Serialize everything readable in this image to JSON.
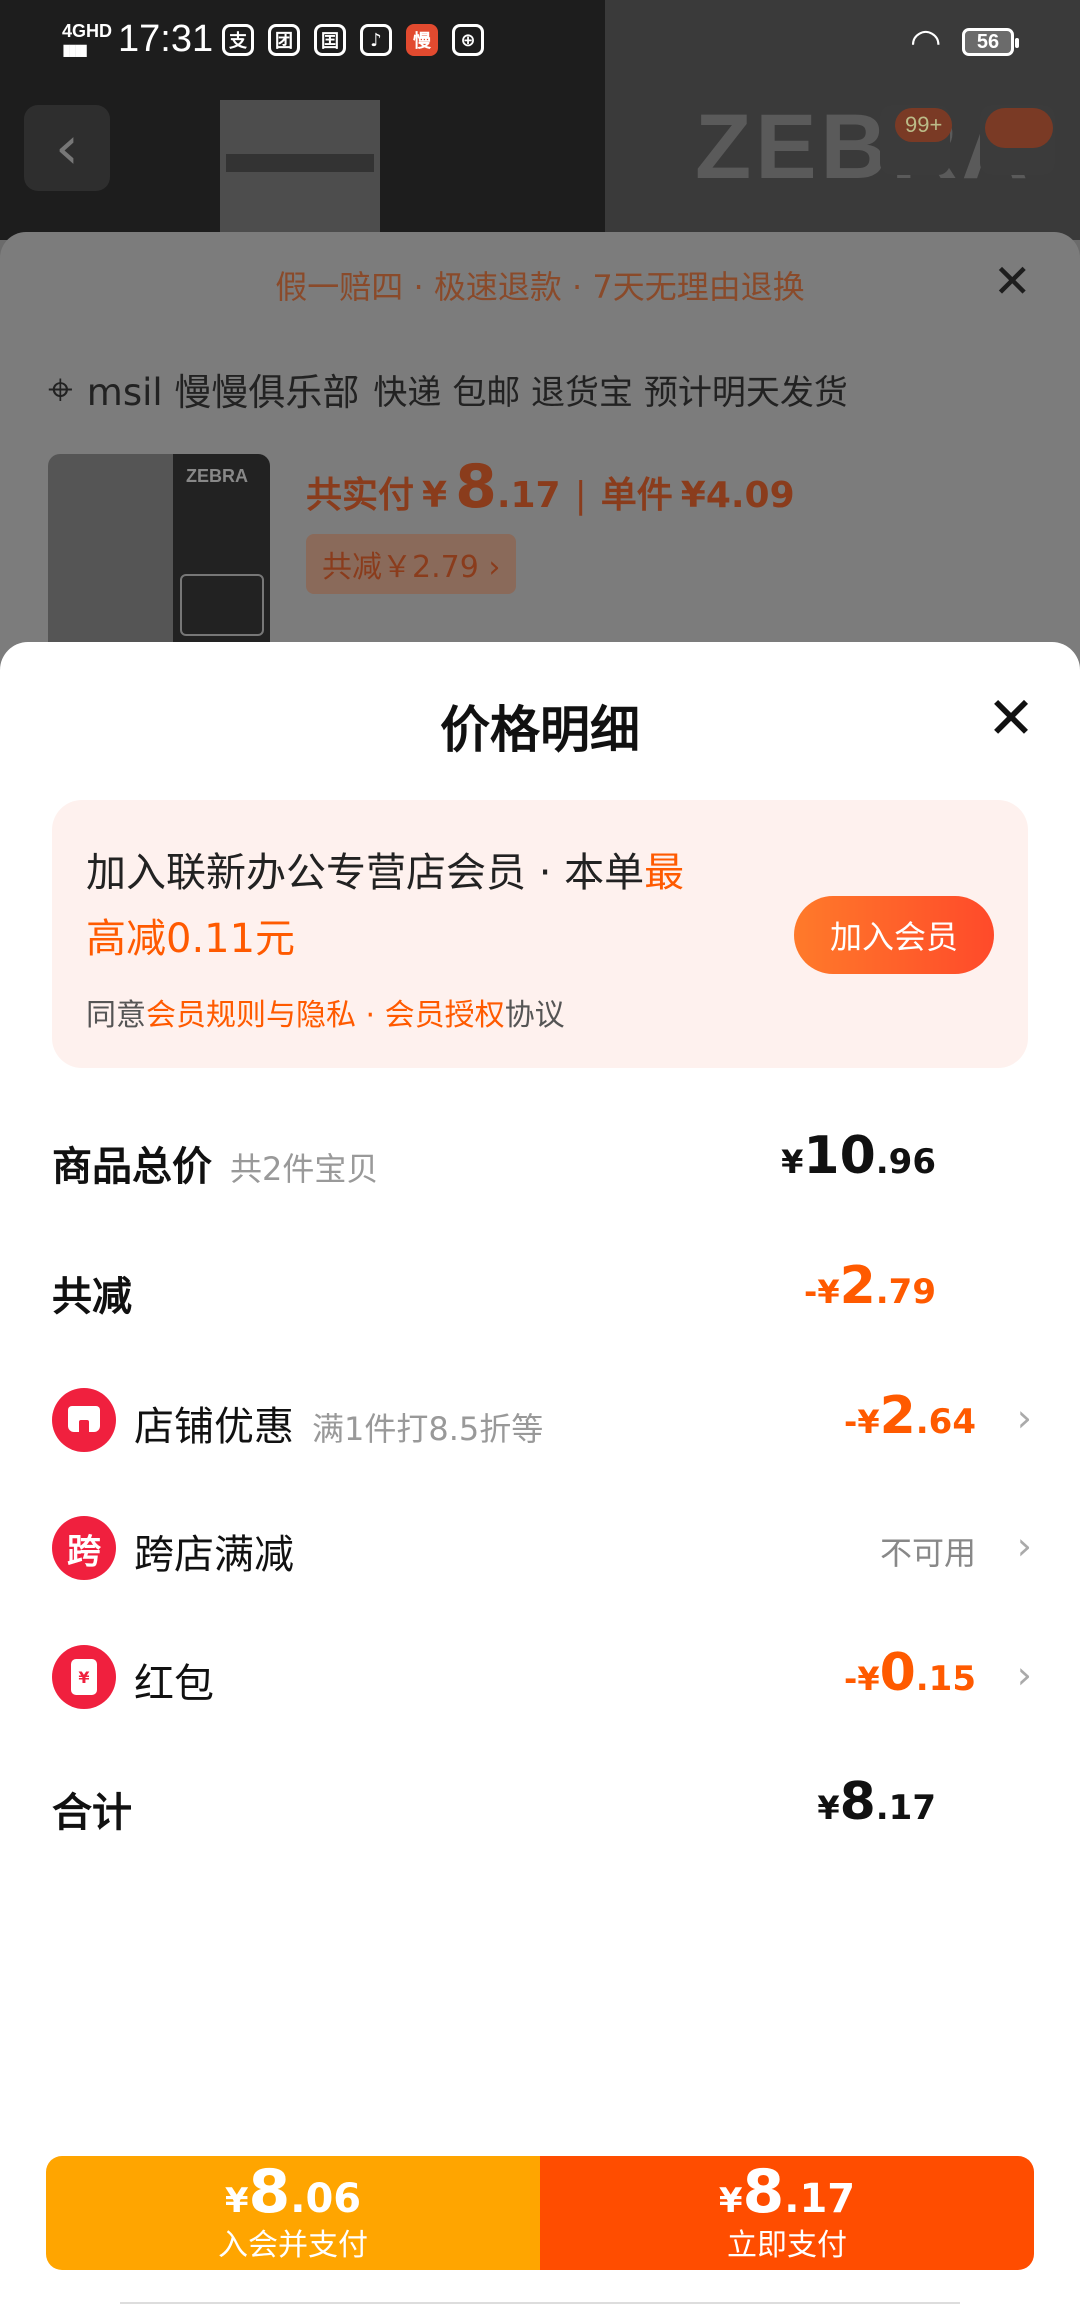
{
  "status_bar": {
    "network": "4GHD",
    "signal": "▮▮▮▮",
    "time": "17:31",
    "app_icons": [
      {
        "glyph": "支",
        "red": false
      },
      {
        "glyph": "团",
        "red": false
      },
      {
        "glyph": "囯",
        "red": false
      },
      {
        "glyph": "♪",
        "red": false
      },
      {
        "glyph": "慢",
        "red": true
      },
      {
        "glyph": "⊕",
        "red": false
      }
    ],
    "battery": "56"
  },
  "background_page": {
    "brand_logo": "ZEBRA",
    "cart_badge": "99+"
  },
  "order_sheet": {
    "banner": "假一赔四 · 极速退款 · 7天无理由退换",
    "address": {
      "name": "msil 慢慢俱乐部",
      "delivery": "快递 包邮 退货宝 预计明天发货"
    },
    "product": {
      "brand": "ZEBRA",
      "paid_label": "共实付",
      "currency": "¥",
      "paid_int": "8",
      "paid_dec": ".17",
      "unit_label": "单件",
      "unit_price": "¥4.09",
      "saved_label": "共减￥2.79 ›"
    }
  },
  "price_detail": {
    "title": "价格明细",
    "close_icon": "✕",
    "member_promo": {
      "line1_prefix": "加入联新办公专营店会员 · 本单",
      "line1_highlight": "最",
      "line2_highlight": "高减0.11元",
      "agree_prefix": "同意",
      "agree_link1": "会员规则与隐私",
      "agree_sep": " · ",
      "agree_link2": "会员授权",
      "agree_suffix": "协议",
      "join_button": "加入会员"
    },
    "rows": {
      "total_goods": {
        "label": "商品总价",
        "sub": "共2件宝贝",
        "currency": "¥",
        "int": "10",
        "dec": ".96"
      },
      "total_discount": {
        "label": "共减",
        "currency": "-¥",
        "int": "2",
        "dec": ".79"
      },
      "store_discount": {
        "label": "店铺优惠",
        "sub": "满1件打8.5折等",
        "currency": "-¥",
        "int": "2",
        "dec": ".64",
        "icon": "store-icon"
      },
      "cross_store": {
        "label": "跨店满减",
        "icon_text": "跨",
        "value": "不可用",
        "icon": "cross-store-icon"
      },
      "red_packet": {
        "label": "红包",
        "icon_text": "¥",
        "currency": "-¥",
        "int": "0",
        "dec": ".15",
        "icon": "red-packet-icon"
      },
      "grand_total": {
        "label": "合计",
        "currency": "¥",
        "int": "8",
        "dec": ".17"
      }
    }
  },
  "pay_bar": {
    "member_pay": {
      "currency": "¥",
      "int": "8",
      "dec": ".06",
      "label": "入会并支付"
    },
    "pay_now": {
      "currency": "¥",
      "int": "8",
      "dec": ".17",
      "label": "立即支付"
    }
  },
  "colors": {
    "accent": "#ff5a00",
    "member_button_orange": "#ffa500",
    "pay_button_red": "#ff4d00",
    "icon_red": "#f0203e"
  }
}
